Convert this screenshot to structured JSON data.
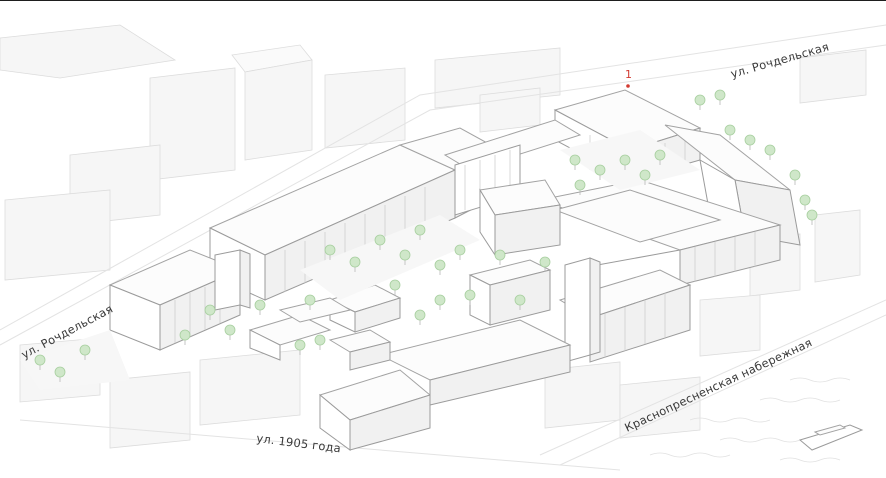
{
  "map": {
    "street_labels": [
      "ул. Рочдельская",
      "ул. Рочдельская",
      "ул. 1905 года",
      "Краснопресненская набережная"
    ],
    "marker": {
      "label": "1",
      "color": "#d23b32"
    },
    "colors": {
      "tree": "#cfe7c9",
      "building_outline": "#9b9b9b",
      "background": "#ffffff"
    }
  }
}
